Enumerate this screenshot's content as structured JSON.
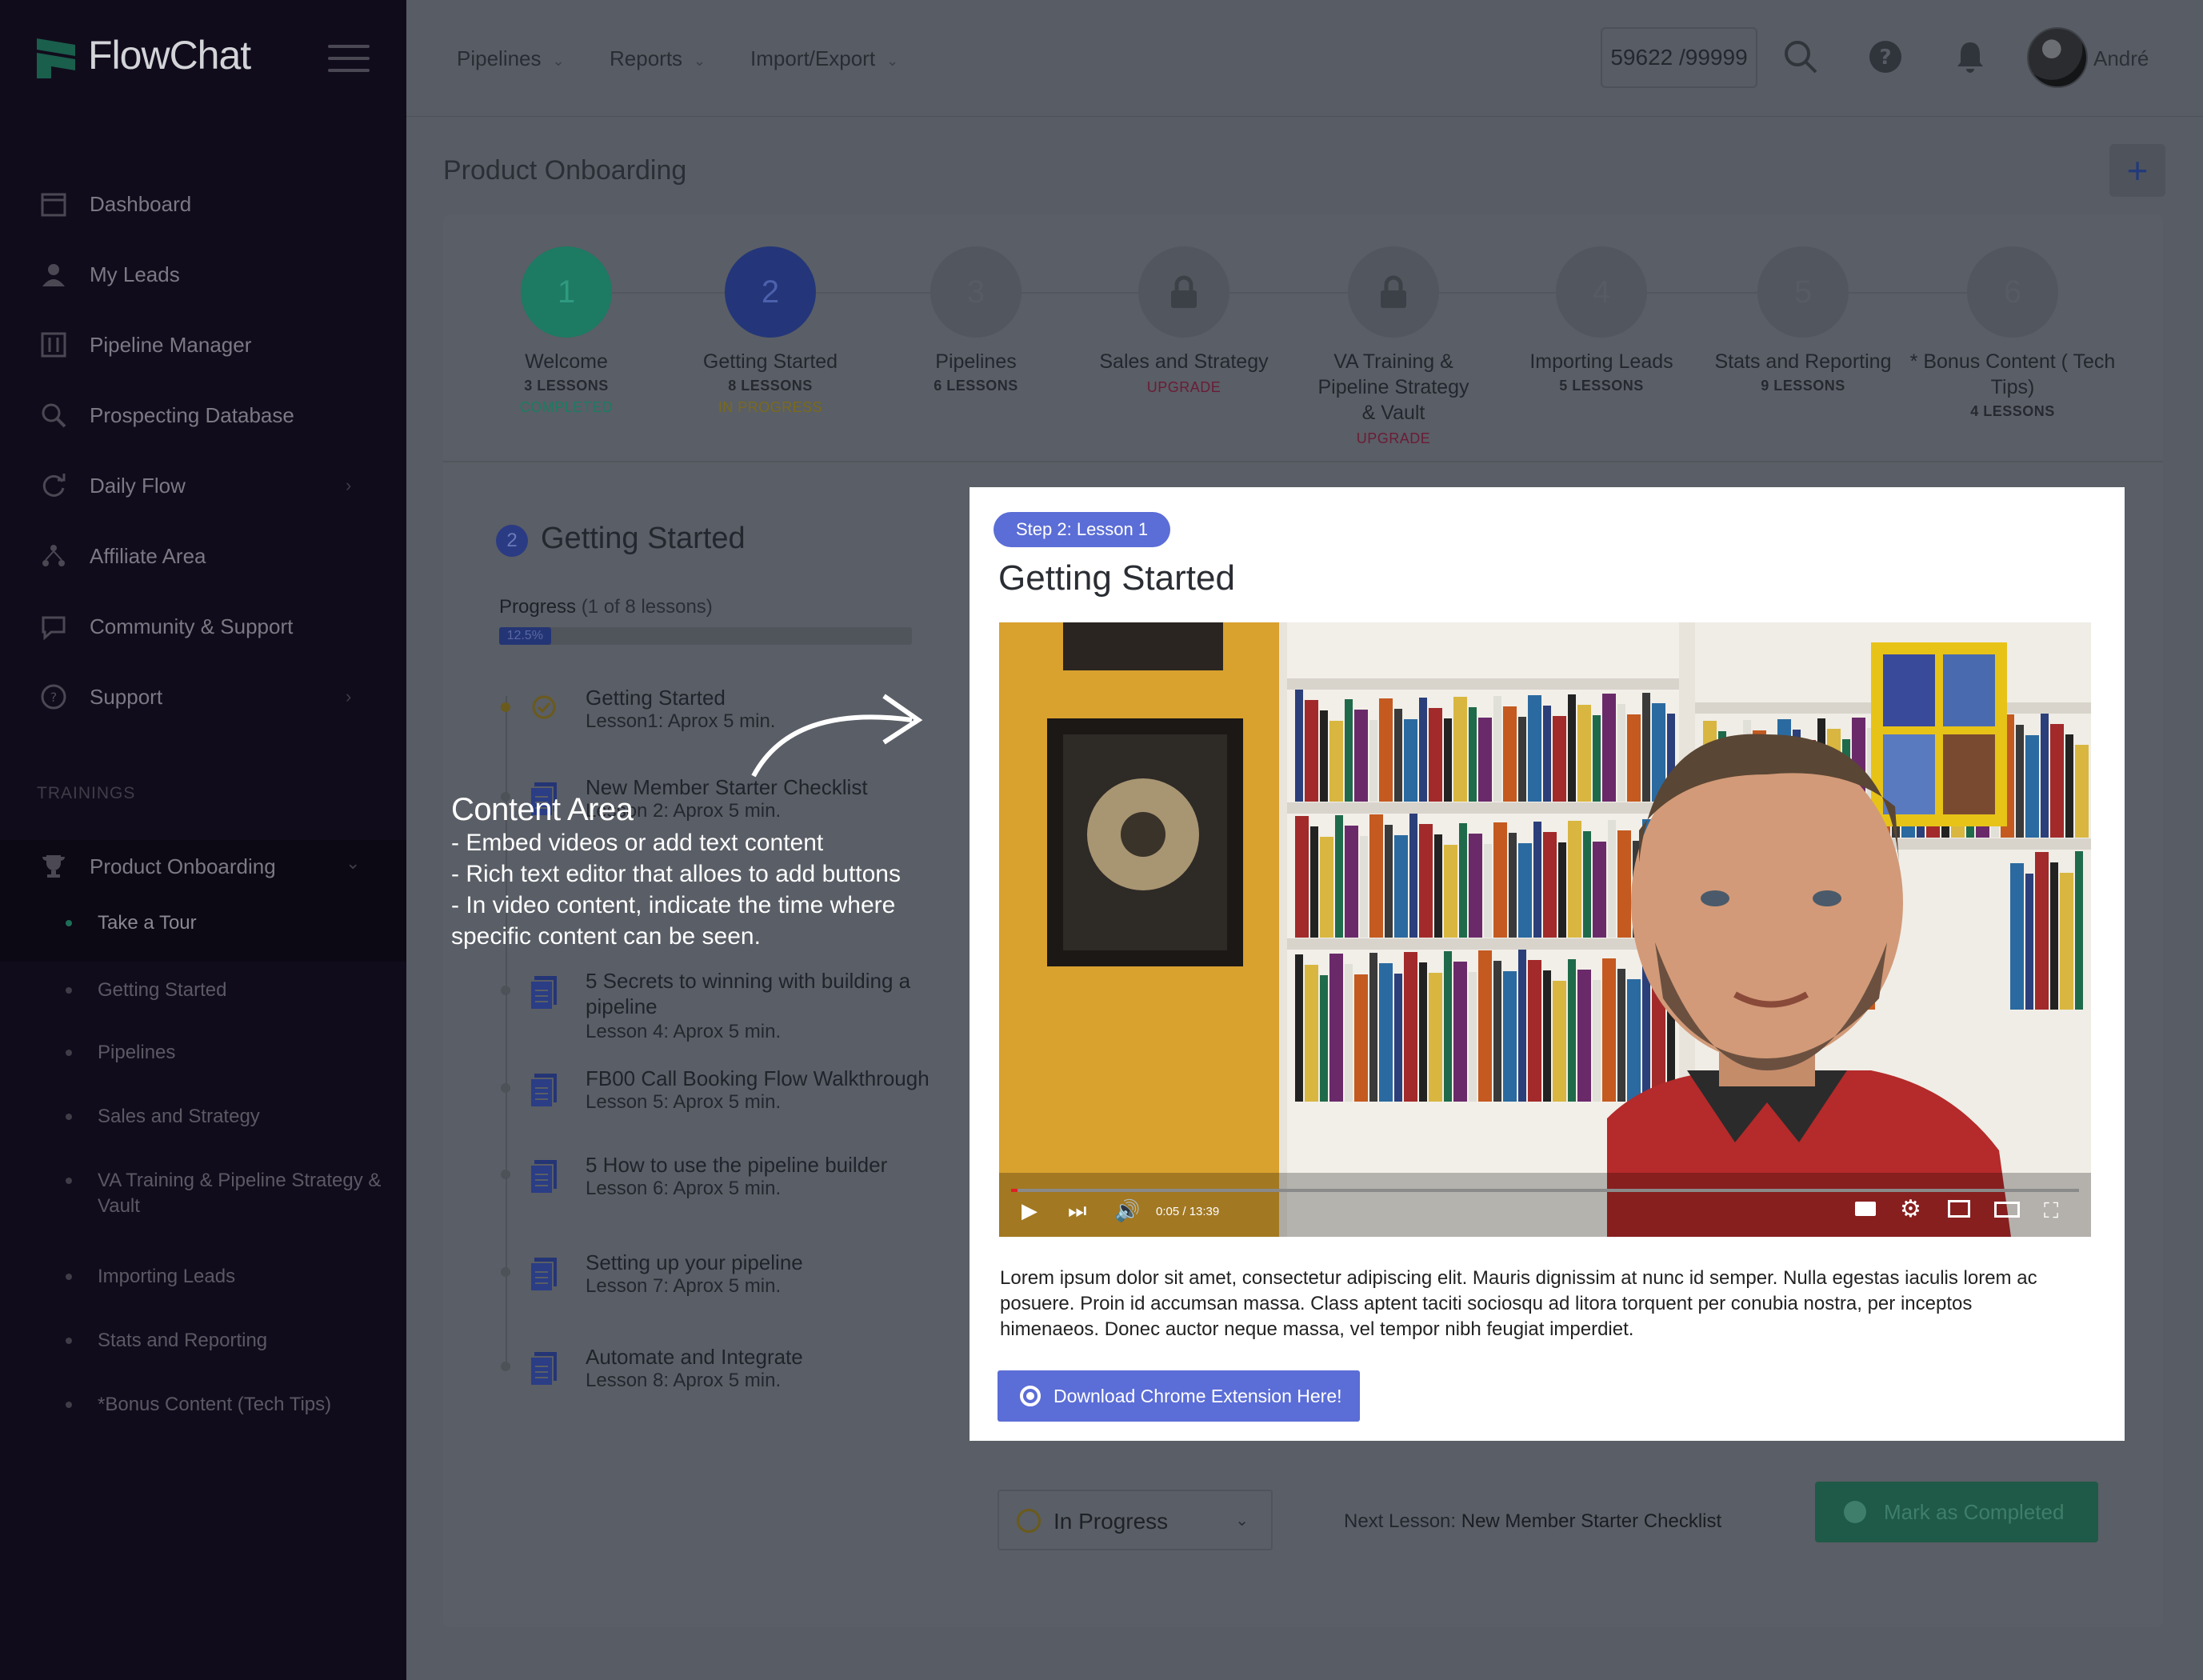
{
  "app": {
    "name": "FlowChat"
  },
  "sidebar": {
    "items": [
      {
        "label": "Dashboard",
        "icon": "calendar-icon"
      },
      {
        "label": "My Leads",
        "icon": "users-icon"
      },
      {
        "label": "Pipeline Manager",
        "icon": "columns-icon"
      },
      {
        "label": "Prospecting Database",
        "icon": "search-icon"
      },
      {
        "label": "Daily Flow",
        "icon": "refresh-icon"
      },
      {
        "label": "Affiliate Area",
        "icon": "network-icon"
      },
      {
        "label": "Community & Support",
        "icon": "chat-icon"
      },
      {
        "label": "Support",
        "icon": "help-icon"
      }
    ],
    "section_label": "TRAININGS",
    "training": {
      "label": "Product Onboarding",
      "sub_items": [
        "Take a Tour",
        "Getting Started",
        "Pipelines",
        "Sales and Strategy",
        "VA Training & Pipeline Strategy & Vault",
        "Importing Leads",
        "Stats and Reporting",
        "*Bonus Content (Tech Tips)"
      ]
    }
  },
  "topbar": {
    "menus": [
      "Pipelines",
      "Reports",
      "Import/Export"
    ],
    "credits": "59622 /99999",
    "user_name": "André"
  },
  "page": {
    "title": "Product Onboarding",
    "add_label": "+"
  },
  "steps": [
    {
      "num": "1",
      "name": "Welcome",
      "lessons": "3 LESSONS",
      "status": "COMPLETED",
      "status_color": "#1c7c62",
      "circle_color": "#1d7a63"
    },
    {
      "num": "2",
      "name": "Getting Started",
      "lessons": "8 LESSONS",
      "status": "IN PROGRESS",
      "status_color": "#7a6a1c",
      "circle_color": "#243679"
    },
    {
      "num": "3",
      "name": "Pipelines",
      "lessons": "6 LESSONS",
      "status": ""
    },
    {
      "num": "lock",
      "name": "Sales and Strategy",
      "lessons": "",
      "status": "UPGRADE",
      "status_color": "#6a1c36"
    },
    {
      "num": "lock",
      "name": "VA Training & Pipeline Strategy & Vault",
      "lessons": "",
      "status": "UPGRADE",
      "status_color": "#6a1c36"
    },
    {
      "num": "4",
      "name": "Importing Leads",
      "lessons": "5 LESSONS",
      "status": ""
    },
    {
      "num": "5",
      "name": "Stats and Reporting",
      "lessons": "9 LESSONS",
      "status": ""
    },
    {
      "num": "6",
      "name": "* Bonus Content ( Tech Tips)",
      "lessons": "4 LESSONS",
      "status": ""
    }
  ],
  "lesson_list": {
    "step_num": "2",
    "title": "Getting Started",
    "progress_label": "Progress",
    "progress_count": "(1 of 8 lessons)",
    "progress_value": 0.125,
    "progress_text": "12.5%",
    "lessons": [
      {
        "title": "Getting Started",
        "sub": "Lesson1: Aprox 5 min."
      },
      {
        "title": "New Member Starter Checklist",
        "sub": "Lesson 2: Aprox 5 min."
      },
      {
        "title": "5 Secrets to winning with building a pipeline",
        "sub": "Lesson 4: Aprox 5 min."
      },
      {
        "title": "FB00 Call Booking Flow Walkthrough",
        "sub": "Lesson 5: Aprox 5 min."
      },
      {
        "title": "5 How to use the pipeline builder",
        "sub": "Lesson 6: Aprox 5 min."
      },
      {
        "title": "Setting up your pipeline",
        "sub": "Lesson 7: Aprox 5 min."
      },
      {
        "title": "Automate and Integrate",
        "sub": "Lesson 8: Aprox 5 min."
      }
    ]
  },
  "callout": {
    "title": "Content Area",
    "lines": [
      "- Embed videos or add text content",
      "- Rich text editor that alloes to add buttons",
      "- In video content, indicate the time where specific content can be seen."
    ]
  },
  "content": {
    "badge": "Step 2: Lesson 1",
    "title": "Getting Started",
    "video_time": "0:05 / 13:39",
    "video_progress": 0.006,
    "description": "Lorem ipsum dolor sit amet, consectetur adipiscing elit. Mauris dignissim at nunc id semper. Nulla egestas iaculis lorem ac posuere. Proin id accumsan massa. Class aptent taciti sociosqu ad litora torquent per conubia nostra, per inceptos himenaeos. Donec auctor neque massa, vel tempor nibh feugiat imperdiet.",
    "button_label": "Download Chrome Extension Here!"
  },
  "footer": {
    "status_value": "In Progress",
    "next_label": "Next Lesson:",
    "next_title": "New Member Starter Checklist",
    "mark_label": "Mark as Completed"
  }
}
